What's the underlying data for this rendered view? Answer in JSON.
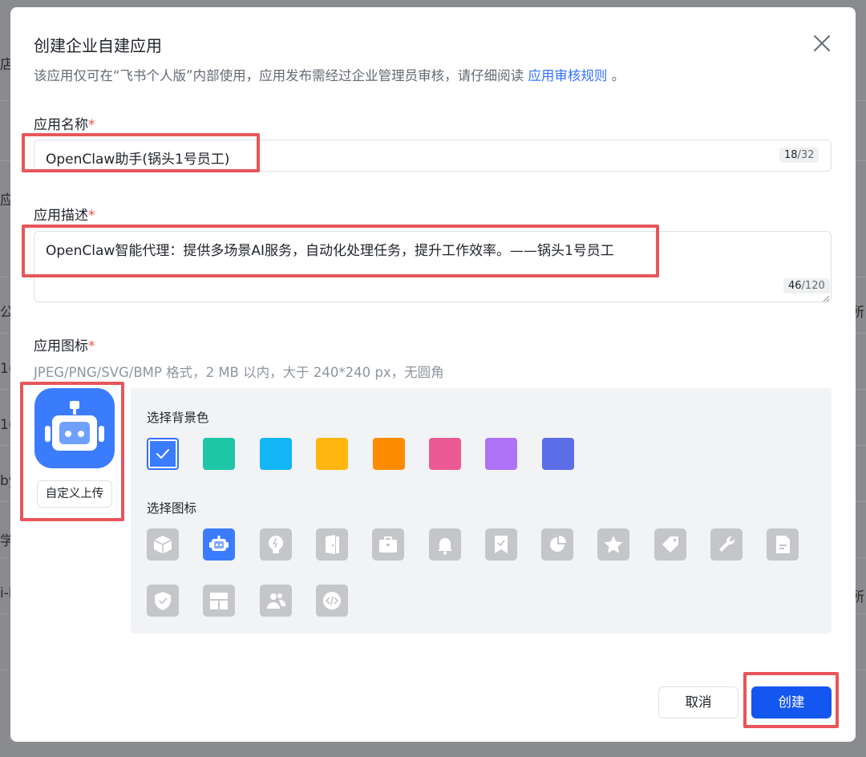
{
  "background": {
    "left_fragments": [
      "店",
      "应",
      "公",
      "1(",
      "1(",
      "by",
      "学/",
      "i-b"
    ],
    "right_fragments": [
      "",
      "",
      "所",
      "",
      "",
      "",
      "",
      "所"
    ]
  },
  "dialog": {
    "title": "创建企业自建应用",
    "subtitle_prefix": "该应用仅可在“飞书个人版”内部使用，应用发布需经过企业管理员审核，请仔细阅读",
    "subtitle_link": "应用审核规则",
    "subtitle_suffix": " 。",
    "close_icon": "close-icon"
  },
  "name_field": {
    "label": "应用名称",
    "required_mark": "*",
    "value": "OpenClaw助手(锅头1号员工)",
    "count_current": "18",
    "count_max": "/32"
  },
  "desc_field": {
    "label": "应用描述",
    "required_mark": "*",
    "value": "OpenClaw智能代理：提供多场景AI服务，自动化处理任务，提升工作效率。——锅头1号员工",
    "count_current": "46",
    "count_max": "/120"
  },
  "icon_field": {
    "label": "应用图标",
    "required_mark": "*",
    "hint": "JPEG/PNG/SVG/BMP 格式，2 MB 以内，大于 240*240 px，无圆角",
    "upload_label": "自定义上传",
    "preview_icon": "robot-icon",
    "preview_color": "#3b7cff"
  },
  "bg_colors": {
    "label": "选择背景色",
    "selected_index": 0,
    "colors": [
      "#3b7cff",
      "#1dc6a4",
      "#14b6f5",
      "#ffb70f",
      "#ff8c00",
      "#eb5a94",
      "#ad72f5",
      "#5b6ee8"
    ]
  },
  "icons": {
    "label": "选择图标",
    "selected_index": 1,
    "names": [
      "cube-icon",
      "robot-icon",
      "lightbulb-icon",
      "door-icon",
      "briefcase-icon",
      "bell-icon",
      "bookmark-check-icon",
      "pie-chart-icon",
      "star-icon",
      "tag-icon",
      "wrench-icon",
      "document-icon",
      "shield-check-icon",
      "layout-icon",
      "users-icon",
      "code-icon"
    ]
  },
  "footer": {
    "cancel_label": "取消",
    "create_label": "创建"
  },
  "colors": {
    "accent": "#1456f0",
    "link": "#3370ff",
    "annotation_red": "#e8555a",
    "required": "#f54a45"
  }
}
